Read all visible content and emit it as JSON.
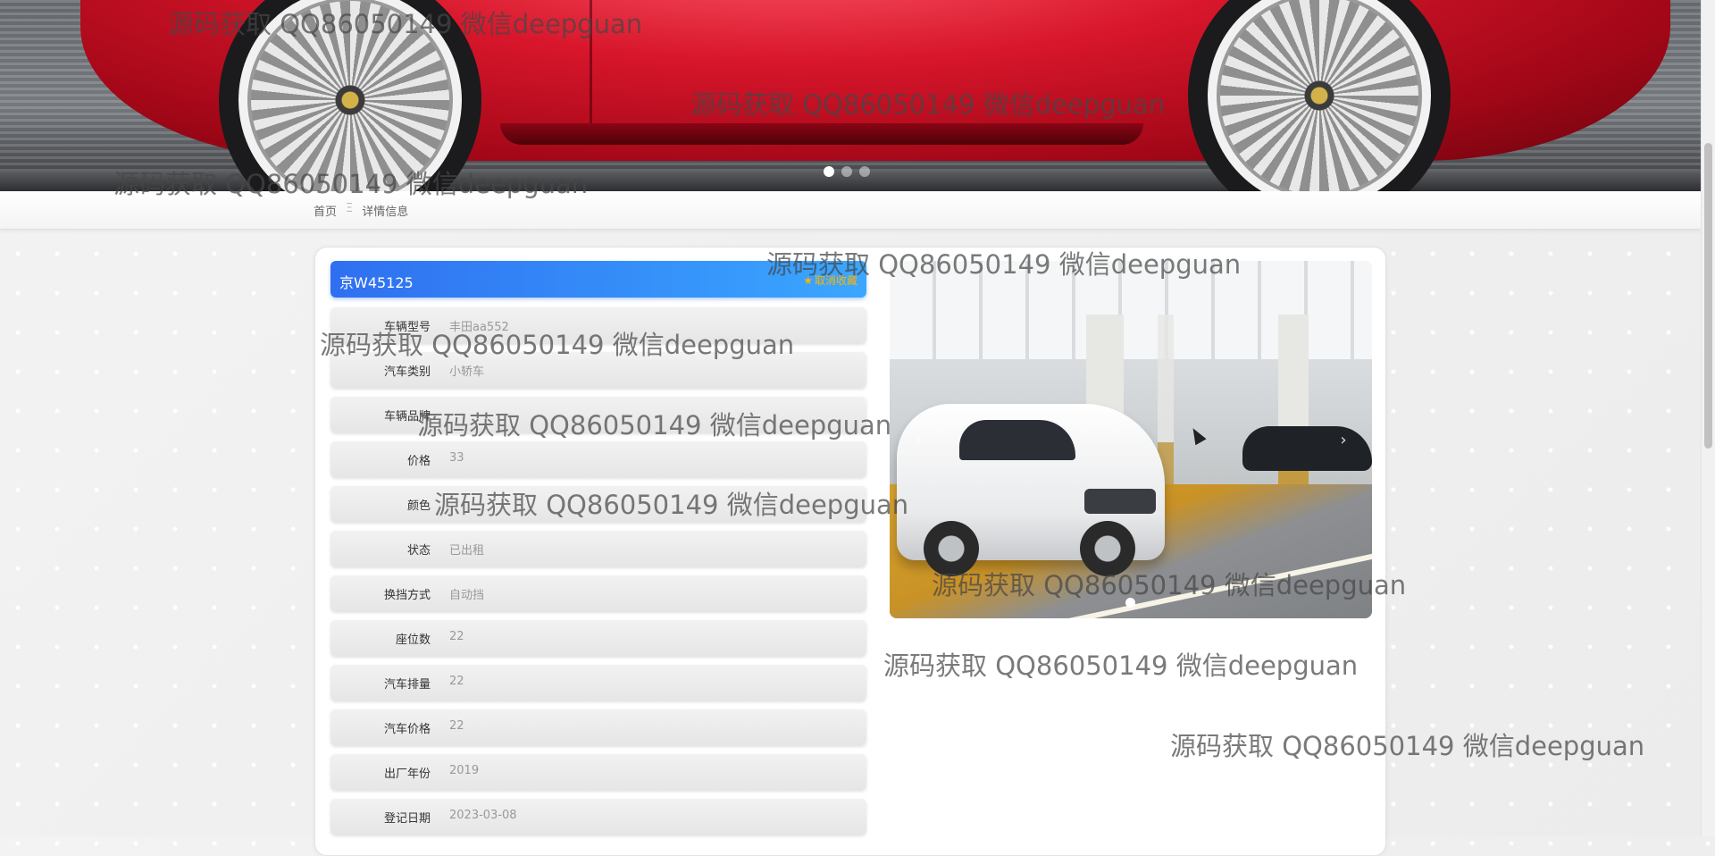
{
  "banner": {
    "slide_count": 3,
    "active_slide": 1
  },
  "breadcrumb": {
    "home": "首页",
    "separator": "Ξ",
    "current": "详情信息"
  },
  "detail": {
    "title": "京W45125",
    "favorite_button": "取消收藏",
    "favorite_icon": "star-icon",
    "fields": [
      {
        "label": "车辆型号",
        "value": "丰田aa552"
      },
      {
        "label": "汽车类别",
        "value": "小轿车"
      },
      {
        "label": "车辆品牌",
        "value": ""
      },
      {
        "label": "价格",
        "value": "33"
      },
      {
        "label": "颜色",
        "value": ""
      },
      {
        "label": "状态",
        "value": "已出租"
      },
      {
        "label": "换挡方式",
        "value": "自动挡"
      },
      {
        "label": "座位数",
        "value": "22"
      },
      {
        "label": "汽车排量",
        "value": "22"
      },
      {
        "label": "汽车价格",
        "value": "22"
      },
      {
        "label": "出厂年份",
        "value": "2019"
      },
      {
        "label": "登记日期",
        "value": "2023-03-08"
      }
    ]
  },
  "gallery": {
    "prev_label": "‹",
    "next_label": "›",
    "slide_count": 1,
    "active_slide": 1
  },
  "watermark": {
    "text": "源码获取 QQ86050149 微信deepguan"
  },
  "colors": {
    "title_bar_start": "#2f6ff0",
    "title_bar_end": "#3aa7ff",
    "favorite": "#ffb400"
  }
}
